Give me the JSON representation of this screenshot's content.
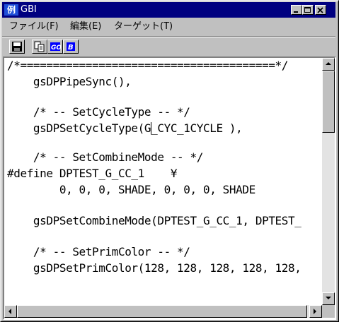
{
  "window": {
    "title": "GBI",
    "icon_glyph": "例",
    "icon_name": "app-icon",
    "controls": [
      "minimize-icon",
      "maximize-icon",
      "close-icon"
    ]
  },
  "menu": {
    "items": [
      "ファイル(F)",
      "編集(E)",
      "ターゲット(T)"
    ]
  },
  "toolbar": {
    "buttons": [
      "save-icon",
      "copy-icon",
      "build-icon",
      "run-icon"
    ]
  },
  "editor": {
    "lines": [
      "/*=======================================*/",
      "    gsDPPipeSync(),",
      "",
      "    /* -- SetCycleType -- */",
      "    gsDPSetCycleType(G",
      "",
      "    /* -- SetCombineMode -- */",
      "#define DPTEST_G_CC_1    ¥",
      "        0, 0, 0, SHADE, 0, 0, 0, SHADE",
      "",
      "    gsDPSetCombineMode(DPTEST_G_CC_1, DPTEST_",
      "",
      "    /* -- SetPrimColor -- */",
      "    gsDPSetPrimColor(128, 128, 128, 128, 128,"
    ],
    "caret_line_tail": "_CYC_1CYCLE ),"
  },
  "colors": {
    "titlebar": "#000080",
    "face": "#c0c0c0",
    "editor_bg": "#ffffff"
  }
}
